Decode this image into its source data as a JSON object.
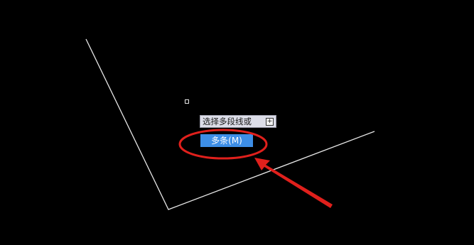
{
  "command_prompt": {
    "text": "选择多段线或",
    "expand_icon": "plus-box-icon"
  },
  "option_menu": {
    "items": [
      {
        "label": "多条(M)",
        "selected": true
      }
    ]
  },
  "colors": {
    "canvas_background": "#000000",
    "geometry_lines": "#e6e6e6",
    "tooltip_background": "#dcdde8",
    "option_highlight": "#3d8ee6",
    "annotation_red": "#e0201c"
  }
}
